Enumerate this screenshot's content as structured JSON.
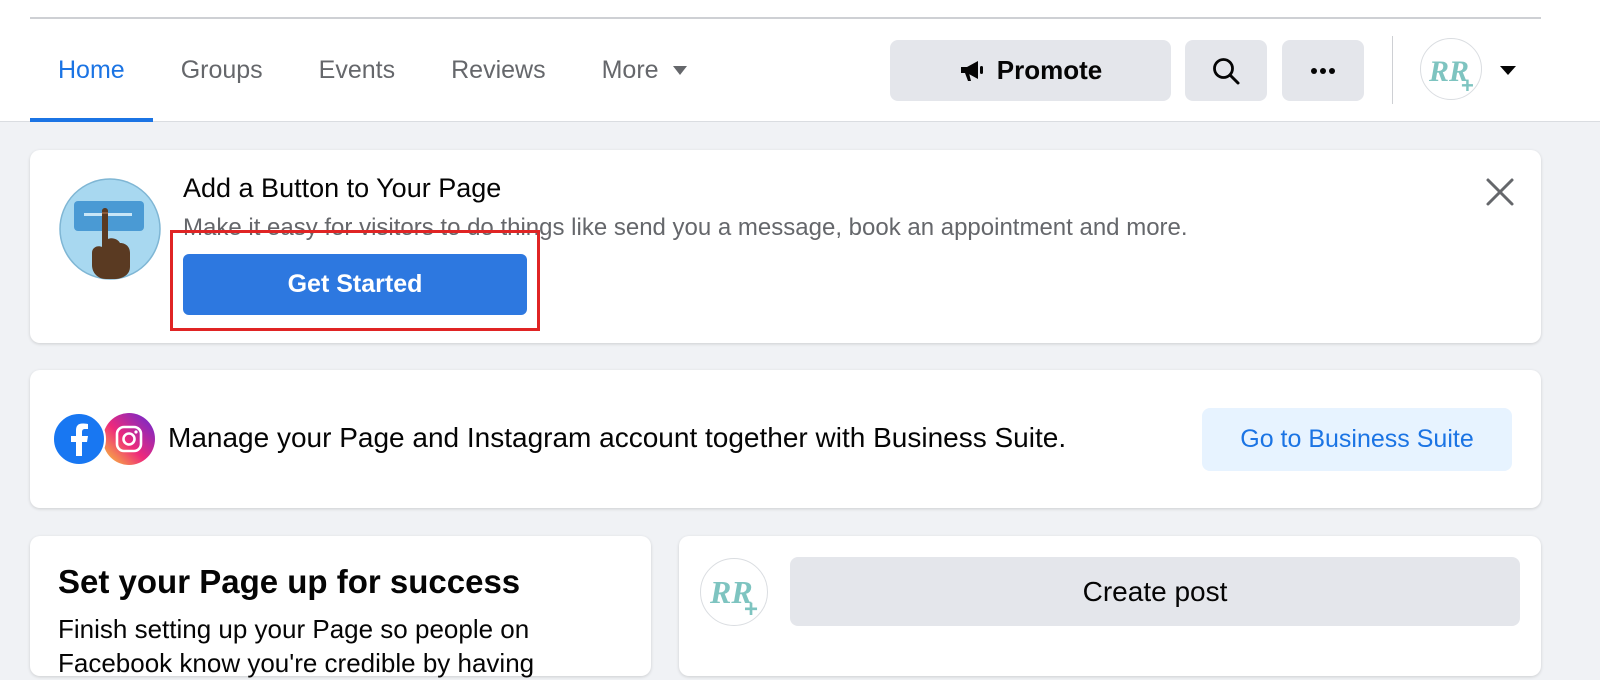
{
  "nav": {
    "tabs": [
      {
        "label": "Home",
        "active": true
      },
      {
        "label": "Groups",
        "active": false
      },
      {
        "label": "Events",
        "active": false
      },
      {
        "label": "Reviews",
        "active": false
      },
      {
        "label": "More",
        "active": false
      }
    ],
    "promote_label": "Promote",
    "search_icon": "search-icon",
    "more_icon": "ellipsis-icon",
    "avatar_text": "RR+"
  },
  "add_button_card": {
    "title": "Add a Button to Your Page",
    "description": "Make it easy for visitors to do things like send you a message, book an appointment and more.",
    "cta_label": "Get Started"
  },
  "business_suite_card": {
    "text": "Manage your Page and Instagram account together with Business Suite.",
    "button_label": "Go to Business Suite"
  },
  "success_card": {
    "title": "Set your Page up for success",
    "description": "Finish setting up your Page so people on Facebook know you're credible by having"
  },
  "post_card": {
    "create_post_label": "Create post",
    "avatar_text": "RR+"
  },
  "colors": {
    "accent": "#1b74e4",
    "button_primary": "#2d78e0",
    "highlight": "#e02424",
    "background": "#f0f2f5"
  }
}
